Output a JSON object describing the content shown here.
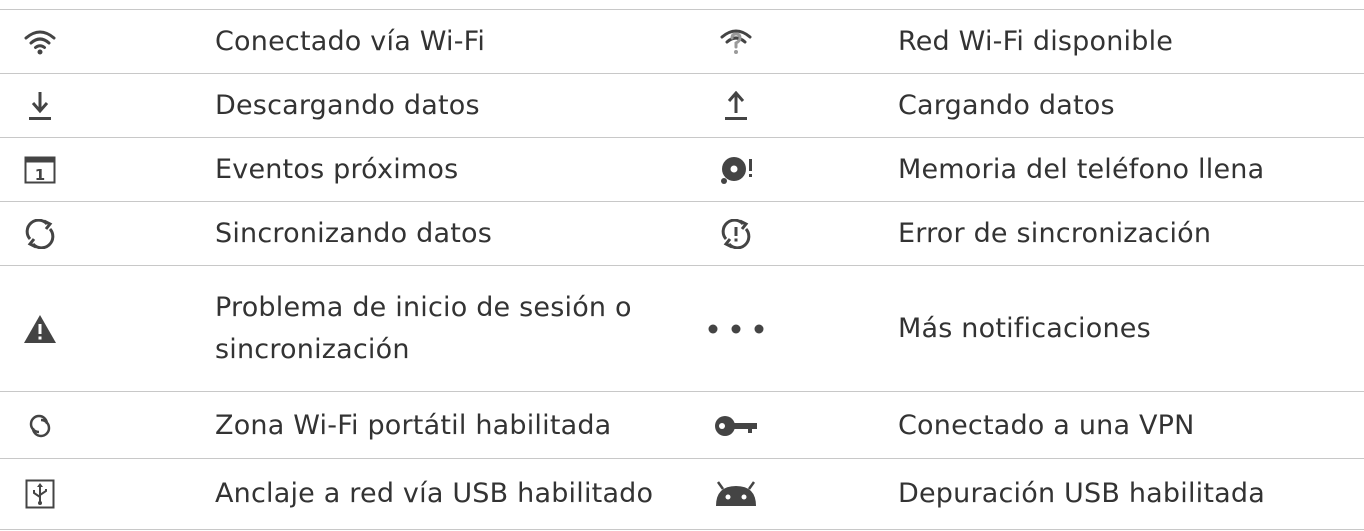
{
  "rows": [
    {
      "left": {
        "icon": "wifi-connected-icon",
        "label": "Conectado vía Wi-Fi"
      },
      "right": {
        "icon": "wifi-available-icon",
        "label": "Red Wi-Fi disponible"
      }
    },
    {
      "left": {
        "icon": "download-icon",
        "label": "Descargando datos"
      },
      "right": {
        "icon": "upload-icon",
        "label": "Cargando datos"
      }
    },
    {
      "left": {
        "icon": "calendar-icon",
        "label": "Eventos próximos"
      },
      "right": {
        "icon": "storage-full-icon",
        "label": "Memoria del teléfono llena"
      }
    },
    {
      "left": {
        "icon": "sync-icon",
        "label": "Sincronizando datos"
      },
      "right": {
        "icon": "sync-error-icon",
        "label": "Error de sincronización"
      }
    },
    {
      "left": {
        "icon": "warning-icon",
        "label": "Problema de inicio de sesión o sincronización"
      },
      "right": {
        "icon": "more-icon",
        "label": "Más notificaciones"
      }
    },
    {
      "left": {
        "icon": "hotspot-icon",
        "label": "Zona Wi-Fi portátil habilitada"
      },
      "right": {
        "icon": "vpn-key-icon",
        "label": "Conectado a una VPN"
      }
    },
    {
      "left": {
        "icon": "usb-tethering-icon",
        "label": "Anclaje a red vía USB habilitado"
      },
      "right": {
        "icon": "android-debug-icon",
        "label": "Depuración USB habilitada"
      }
    }
  ],
  "colors": {
    "icon": "#444444",
    "icon_light": "#9a9a9a",
    "text": "#333333",
    "rule": "#c8c8c8"
  }
}
